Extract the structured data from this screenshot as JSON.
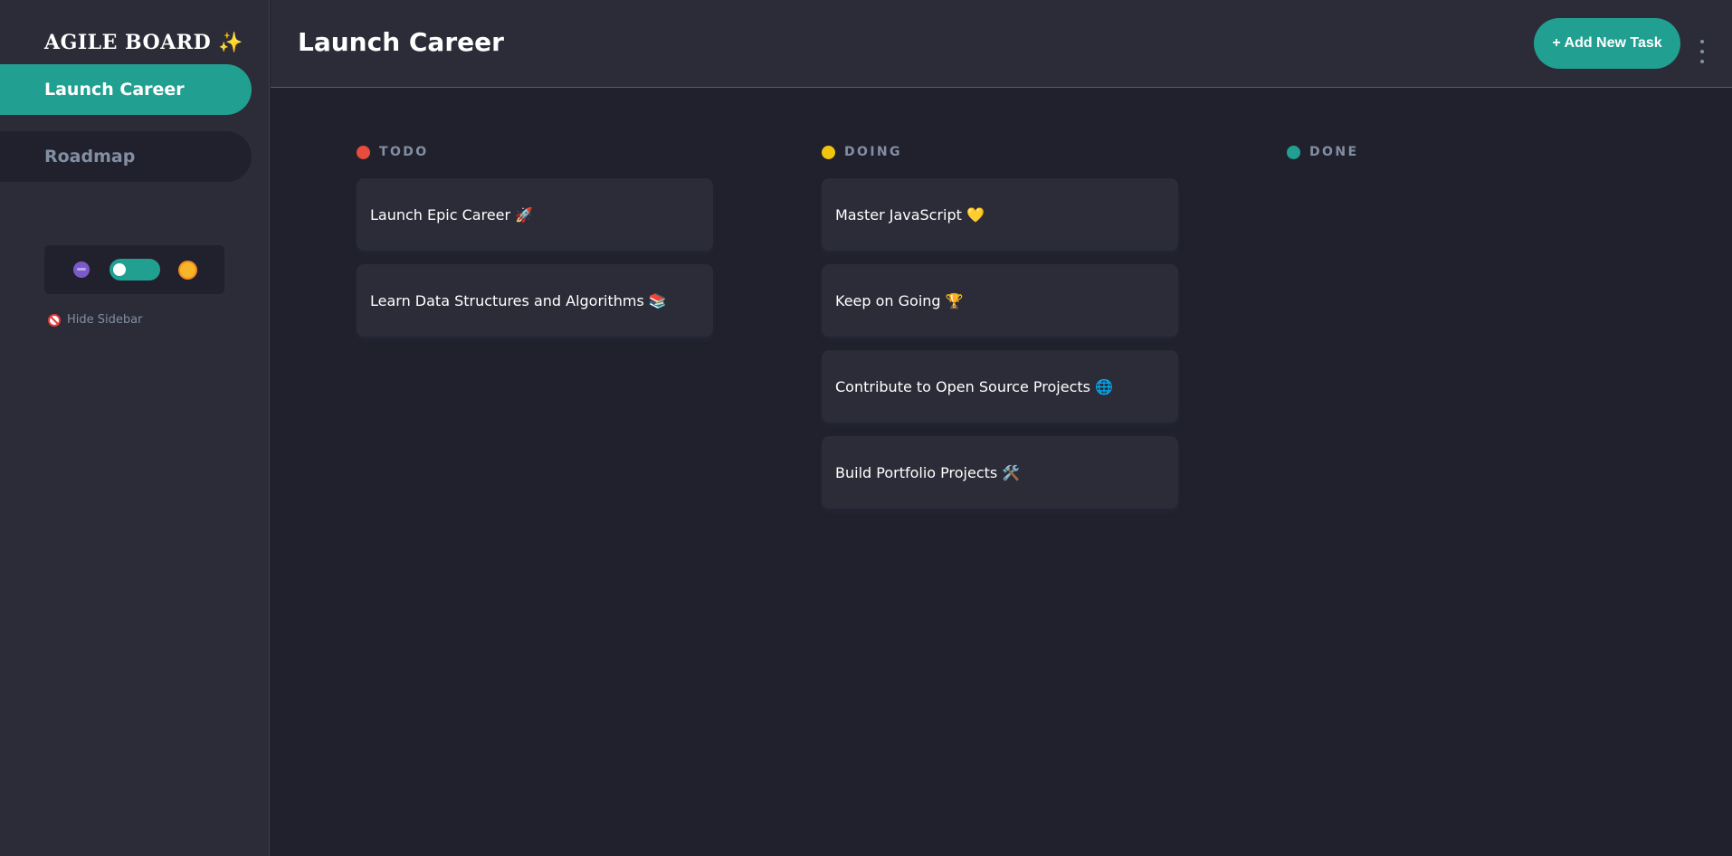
{
  "app": {
    "logo_text": "AGILE BOARD",
    "logo_sparkle": "✨"
  },
  "sidebar": {
    "items": [
      {
        "label": "Launch Career",
        "active": true
      },
      {
        "label": "Roadmap",
        "active": false
      }
    ],
    "theme_toggle": {
      "dark_icon": "moon-icon",
      "light_icon": "sun-icon",
      "state": "on"
    },
    "hide_sidebar_label": "Hide Sidebar"
  },
  "header": {
    "title": "Launch Career",
    "add_task_label": "+ Add New Task"
  },
  "columns": [
    {
      "name": "TODO",
      "color": "#e74c3c",
      "tasks": [
        "Launch Epic Career 🚀",
        "Learn Data Structures and Algorithms 📚"
      ]
    },
    {
      "name": "DOING",
      "color": "#f1c40f",
      "tasks": [
        "Master JavaScript 💛",
        "Keep on Going 🏆",
        "Contribute to Open Source Projects 🌐",
        "Build Portfolio Projects 🛠️"
      ]
    },
    {
      "name": "DONE",
      "color": "#21a092",
      "tasks": []
    }
  ],
  "colors": {
    "accent": "#21a092",
    "sidebar_bg": "#2b2c37",
    "board_bg": "#21212d",
    "muted_text": "#828fa3"
  }
}
